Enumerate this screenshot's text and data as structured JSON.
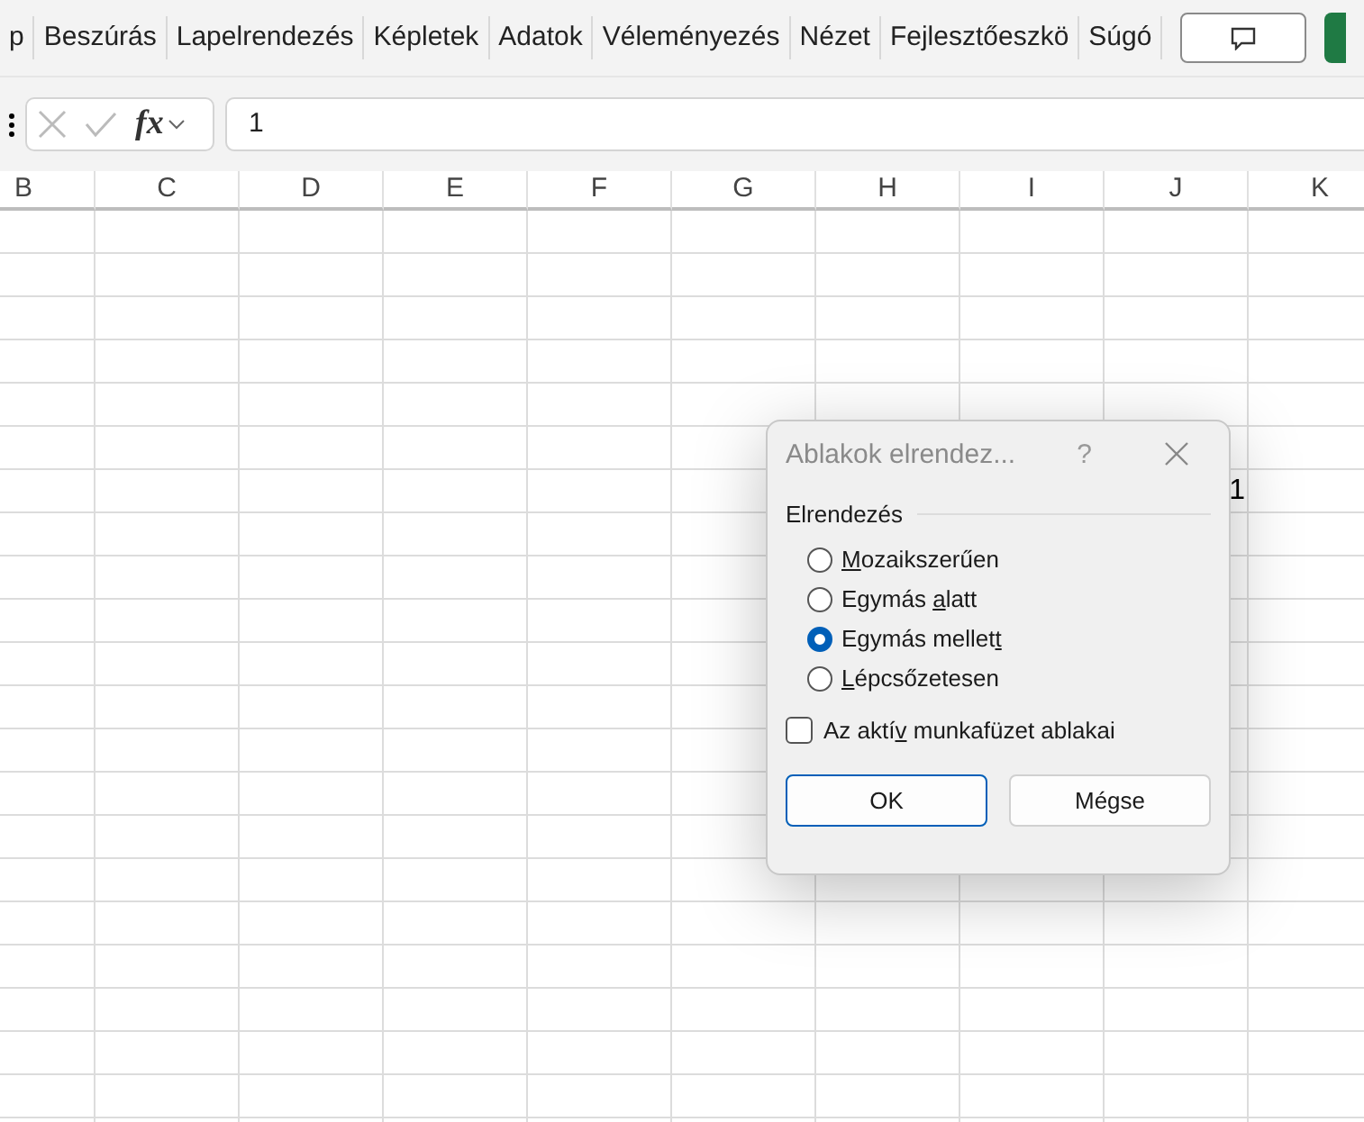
{
  "ribbon": {
    "tabs": [
      {
        "label": "p"
      },
      {
        "label": "Beszúrás"
      },
      {
        "label": "Lapelrendezés"
      },
      {
        "label": "Képletek"
      },
      {
        "label": "Adatok"
      },
      {
        "label": "Véleményezés"
      },
      {
        "label": "Nézet"
      },
      {
        "label": "Fejlesztőeszkö"
      },
      {
        "label": "Súgó"
      }
    ]
  },
  "formula_bar": {
    "fx_label": "fx",
    "value": "1"
  },
  "sheet": {
    "columns": [
      "B",
      "C",
      "D",
      "E",
      "F",
      "G",
      "H",
      "I",
      "J",
      "K"
    ],
    "cells": [
      {
        "value": "1"
      }
    ]
  },
  "dialog": {
    "title": "Ablakok elrendez...",
    "help": "?",
    "group_label": "Elrendezés",
    "options": [
      {
        "label_parts": {
          "key": "M",
          "after": "ozaikszerűen"
        },
        "selected": false
      },
      {
        "label_parts": {
          "before": "Egymás ",
          "key": "a",
          "after": "latt"
        },
        "selected": false
      },
      {
        "label_parts": {
          "before": "Egymás mellet",
          "key": "t"
        },
        "selected": true
      },
      {
        "label_parts": {
          "key": "L",
          "after": "épcsőzetesen"
        },
        "selected": false
      }
    ],
    "checkbox": {
      "label_parts": {
        "before": "Az aktí",
        "key": "v",
        "after": " munkafüzet ablakai"
      },
      "checked": false
    },
    "buttons": [
      {
        "label": "OK",
        "kind": "default"
      },
      {
        "label": "Mégse",
        "kind": "normal"
      }
    ]
  }
}
